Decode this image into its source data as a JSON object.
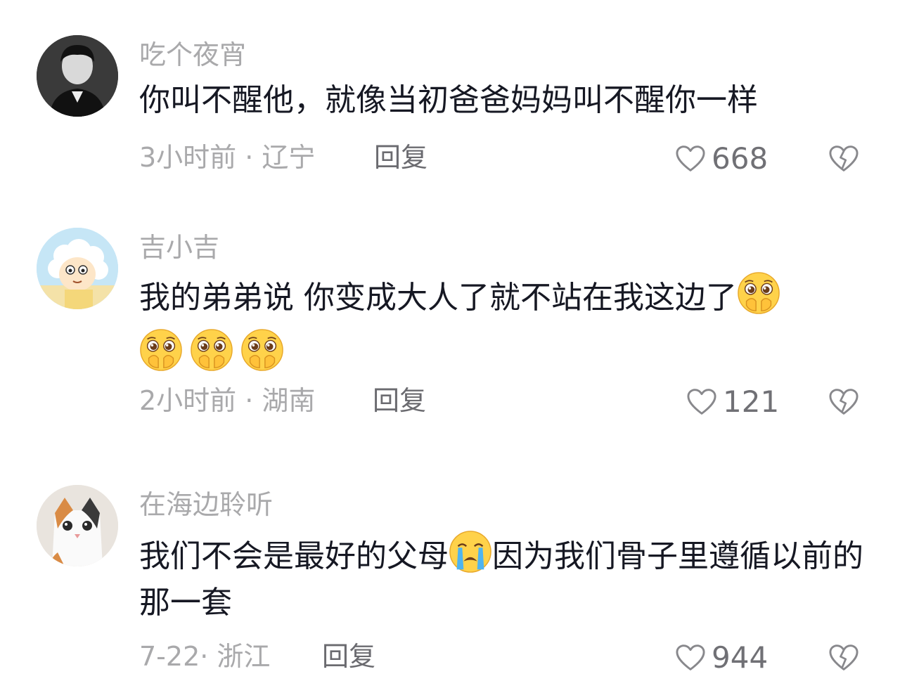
{
  "comments": [
    {
      "username": "吃个夜宵",
      "content": "你叫不醒他，就像当初爸爸妈妈叫不醒你一样",
      "time_location": "3小时前 · 辽宁",
      "reply_label": "回复",
      "likes": "668",
      "avatar_icon": "portrait-photo-icon"
    },
    {
      "username": "吉小吉",
      "content": "我的弟弟说 你变成大人了就不站在我这边了",
      "emoji_icon": "pleading-hands-face-emoji",
      "time_location": "2小时前 · 湖南",
      "reply_label": "回复",
      "likes": "121",
      "avatar_icon": "cartoon-sheep-avatar-icon"
    },
    {
      "username": "在海边聆听",
      "content_before_emoji": "我们不会是最好的父母",
      "emoji_icon": "crying-face-emoji",
      "content_after_emoji": "因为我们骨子里遵循以前的那一套",
      "time_location": "7-22· 浙江",
      "reply_label": "回复",
      "likes": "944",
      "avatar_icon": "cat-photo-avatar-icon"
    }
  ],
  "colors": {
    "text_primary": "#161823",
    "text_secondary": "#a9a9ab",
    "reply": "#6b6b70",
    "emoji_yellow": "#ffcb3d"
  }
}
